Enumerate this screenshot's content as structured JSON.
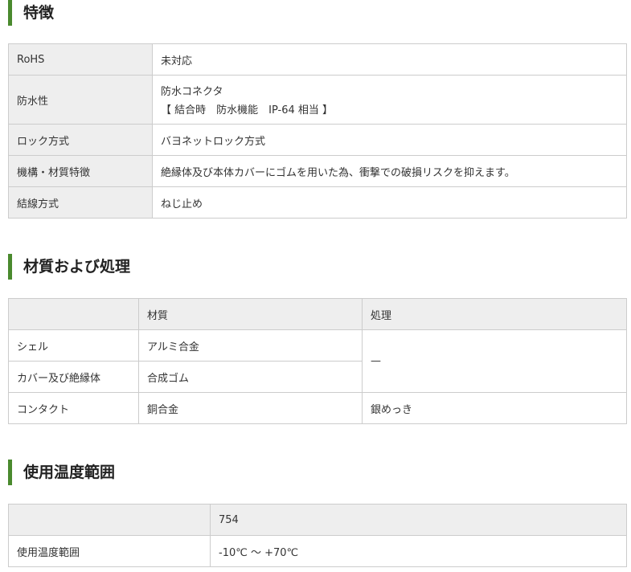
{
  "sections": {
    "features": {
      "title": "特徴",
      "rows": [
        {
          "label": "RoHS",
          "value": "未対応"
        },
        {
          "label": "防水性",
          "value": "防水コネクタ",
          "value2": "【 結合時　防水機能　IP-64 相当 】"
        },
        {
          "label": "ロック方式",
          "value": "バヨネットロック方式"
        },
        {
          "label": "機構・材質特徴",
          "value": "絶縁体及び本体カバーにゴムを用いた為、衝撃での破損リスクを抑えます。"
        },
        {
          "label": "結線方式",
          "value": "ねじ止め"
        }
      ]
    },
    "materials": {
      "title": "材質および処理",
      "headers": [
        "",
        "材質",
        "処理"
      ],
      "rows": [
        {
          "label": "シェル",
          "material": "アルミ合金"
        },
        {
          "label": "カバー及び絶縁体",
          "material": "合成ゴム"
        },
        {
          "label": "コンタクト",
          "material": "銅合金",
          "treatment": "銀めっき"
        }
      ],
      "shared_treatment": "—"
    },
    "temperature": {
      "title": "使用温度範囲",
      "headers": [
        "",
        "754"
      ],
      "rows": [
        {
          "label": "使用温度範囲",
          "value": "-10℃ ～ +70℃"
        }
      ]
    }
  }
}
